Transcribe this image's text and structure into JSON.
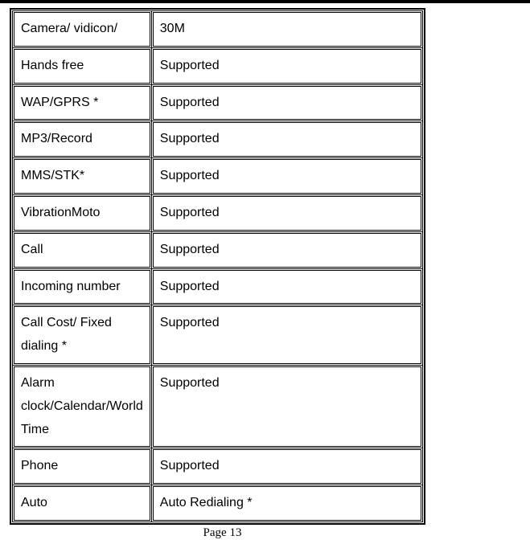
{
  "rows": [
    {
      "label": "Camera/ vidicon/",
      "value": "30M"
    },
    {
      "label": "Hands free",
      "value": "Supported"
    },
    {
      "label": "WAP/GPRS *",
      "value": "Supported"
    },
    {
      "label": "MP3/Record",
      "value": "Supported"
    },
    {
      "label": "MMS/STK*",
      "value": "Supported"
    },
    {
      "label": "VibrationMoto",
      "value": "Supported"
    },
    {
      "label": "Call",
      "value": "Supported"
    },
    {
      "label": "Incoming number",
      "value": "Supported"
    },
    {
      "label": "Call Cost/ Fixed dialing *",
      "value": "Supported"
    },
    {
      "label": "Alarm clock/Calendar/World Time",
      "value": "Supported"
    },
    {
      "label": "Phone",
      "value": "Supported"
    },
    {
      "label": "Auto",
      "value": "Auto Redialing *"
    }
  ],
  "pageNumber": "Page 13"
}
